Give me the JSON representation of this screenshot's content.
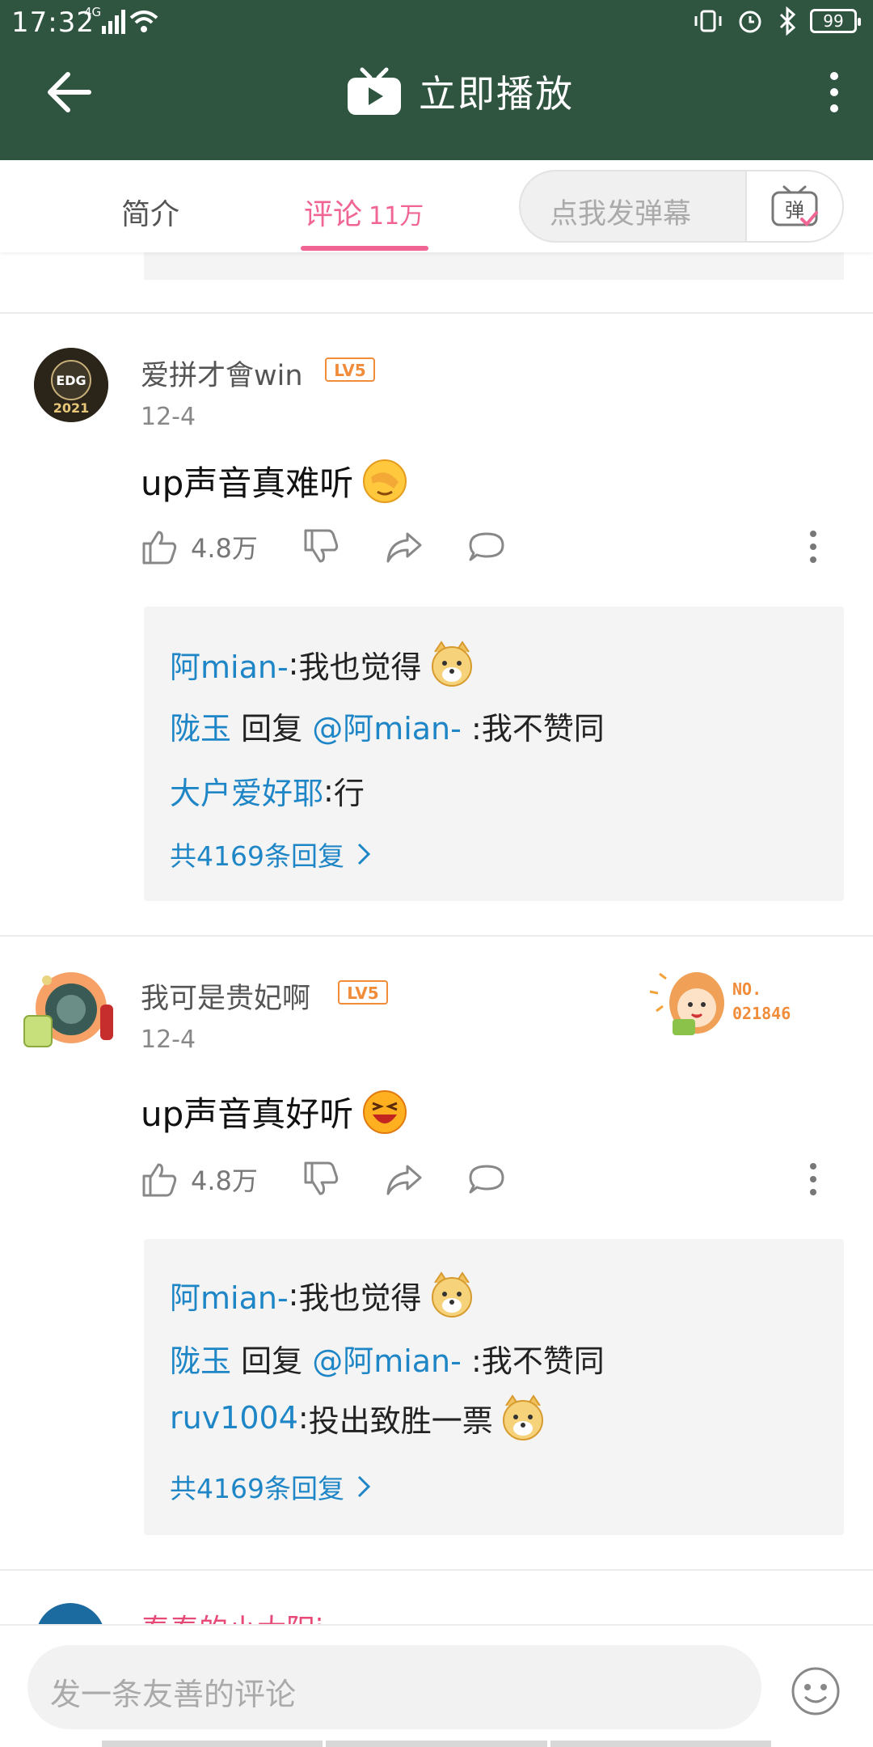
{
  "status_bar": {
    "time": "17:32",
    "network": "4G",
    "battery": "99"
  },
  "app_bar": {
    "title": "立即播放",
    "icons": [
      "back-arrow-icon",
      "tv-play-icon",
      "more-vertical-icon"
    ]
  },
  "tabs": {
    "intro": "简介",
    "comments": "评论",
    "comments_count": "11万",
    "danmaku_placeholder": "点我发弹幕",
    "danmaku_button": "弹"
  },
  "comments": [
    {
      "username": "爱拼才會win",
      "level": "LV5",
      "date": "12-4",
      "text": "up声音真难听",
      "emoji": "facepalm-emoji",
      "likes": "4.8万",
      "replies": [
        {
          "author": "阿mian-",
          "sep": ": ",
          "text": "我也觉得",
          "emoji": "doge-emoji"
        },
        {
          "author": "陇玉",
          "mid": " 回复 ",
          "mention": "@阿mian-",
          "text": " :我不赞同"
        },
        {
          "author": "大户爱好耶",
          "sep": ": ",
          "text": "行"
        }
      ],
      "more_replies": "共4169条回复"
    },
    {
      "username": "我可是贵妃啊",
      "level": "LV5",
      "date": "12-4",
      "text": "up声音真好听",
      "emoji": "laughing-emoji",
      "likes": "4.8万",
      "badge": {
        "no_label": "NO.",
        "no_value": "021846"
      },
      "replies": [
        {
          "author": "阿mian-",
          "sep": ": ",
          "text": "我也觉得",
          "emoji": "doge-emoji"
        },
        {
          "author": "陇玉",
          "mid": " 回复 ",
          "mention": "@阿mian-",
          "text": " :我不赞同"
        },
        {
          "author": "ruv1004",
          "sep": ": ",
          "text": "投出致胜一票",
          "emoji": "doge-emoji"
        }
      ],
      "more_replies": "共4169条回复"
    }
  ],
  "next_comment_peek": {
    "username": "秦秦的小太阳i"
  },
  "avatar_texts": {
    "edg": "EDG",
    "year": "2021"
  },
  "bottom_bar": {
    "placeholder": "发一条友善的评论"
  },
  "colors": {
    "header": "#2f5541",
    "accent_pink": "#f06593",
    "link_blue": "#1e86c6",
    "level_orange": "#f08c3a"
  }
}
